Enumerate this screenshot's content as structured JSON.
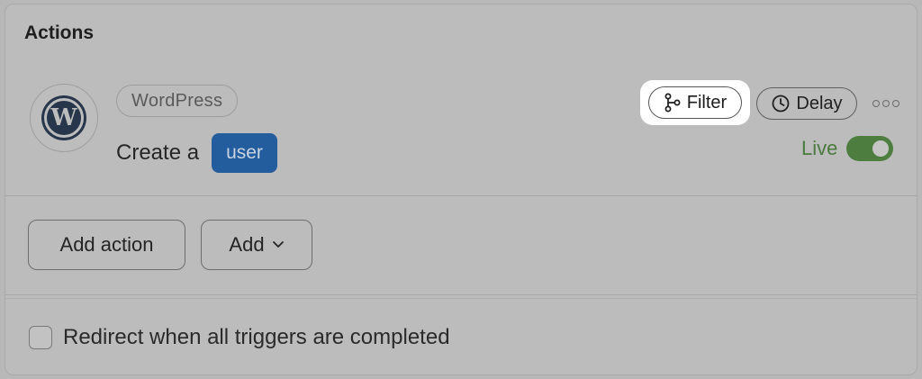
{
  "section": {
    "title": "Actions"
  },
  "action": {
    "app_name": "WordPress",
    "app_icon": "wordpress-icon",
    "prefix": "Create a",
    "field": "user",
    "filter_label": "Filter",
    "delay_label": "Delay",
    "status_label": "Live",
    "status_on": true
  },
  "buttons": {
    "add_action": "Add action",
    "add": "Add"
  },
  "options": {
    "redirect_label": "Redirect when all triggers are completed",
    "redirect_checked": false
  },
  "colors": {
    "field_chip": "#245d9e",
    "live_green": "#4d7e3f",
    "highlight": "#ffffff"
  }
}
